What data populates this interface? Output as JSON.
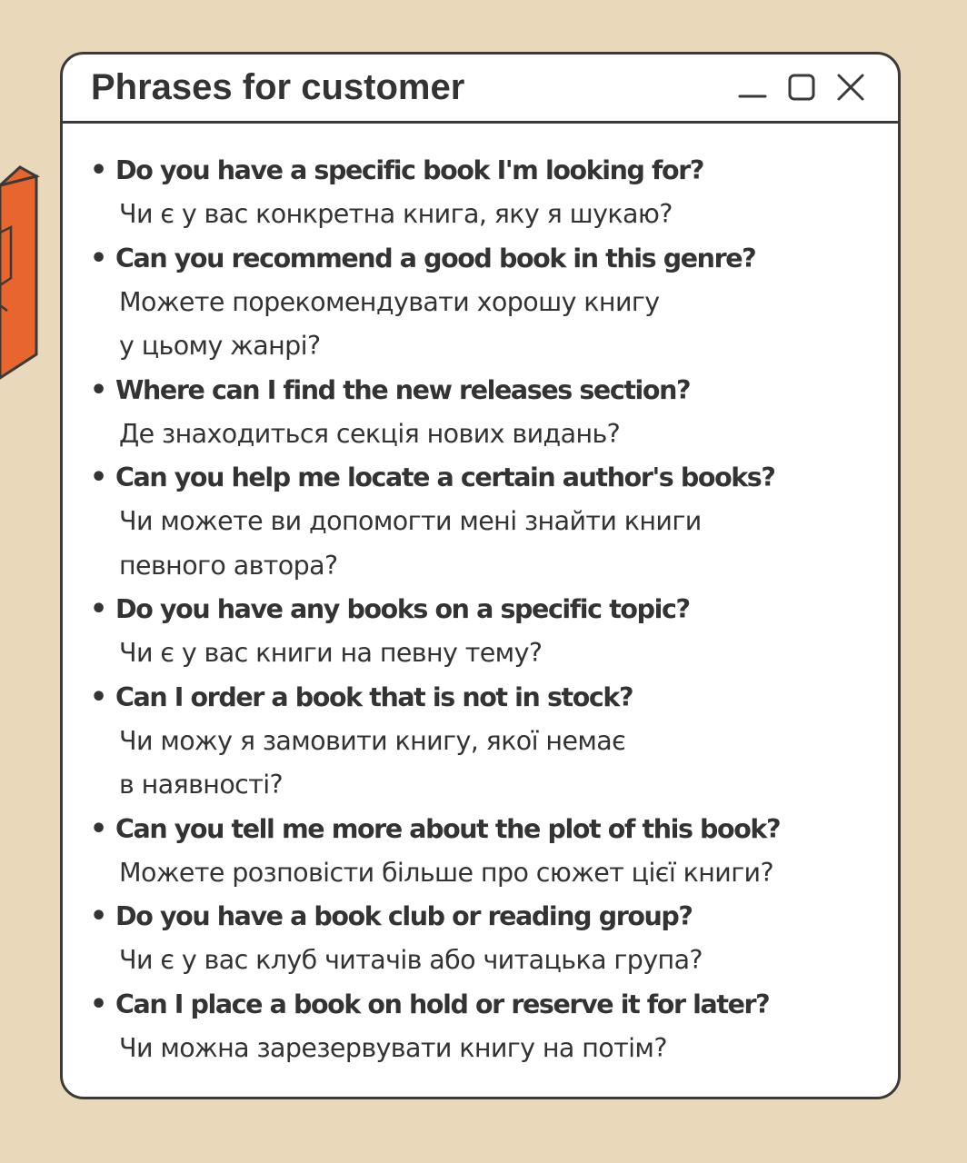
{
  "window": {
    "title": "Phrases for customer"
  },
  "colors": {
    "background": "#ead8bb",
    "accent": "#e8652e",
    "text": "#333333",
    "border": "#3a3a3a"
  },
  "icons": {
    "minimize": "minimize-icon",
    "maximize": "maximize-icon",
    "close": "close-icon"
  },
  "phrases": [
    {
      "en": "Do you have a specific book I'm looking for?",
      "uk": "Чи є у вас конкретна книга, яку я шукаю?"
    },
    {
      "en": "Can you recommend a good book in this genre?",
      "uk": "Можете порекомендувати хорошу книгу\nу цьому жанрі?"
    },
    {
      "en": "Where can I find the new releases section?",
      "uk": "Де знаходиться секція нових видань?"
    },
    {
      "en": "Can you help me locate a certain author's books?",
      "uk": "Чи можете ви допомогти мені знайти книги\nпевного автора?"
    },
    {
      "en": "Do you have any books on a specific topic?",
      "uk": "Чи є у вас книги на певну тему?"
    },
    {
      "en": "Can I order a book that is not in stock?",
      "uk": "Чи можу я замовити книгу, якої немає\nв наявності?"
    },
    {
      "en": "Can you tell me more about the plot of this book?",
      "uk": "Можете розповісти більше про сюжет цієї книги?"
    },
    {
      "en": "Do you have a book club or reading group?",
      "uk": "Чи є у вас клуб читачів або читацька група?"
    },
    {
      "en": "Can I place a book on hold or reserve it for later?",
      "uk": "Чи можна зарезервувати книгу на потім?"
    }
  ]
}
